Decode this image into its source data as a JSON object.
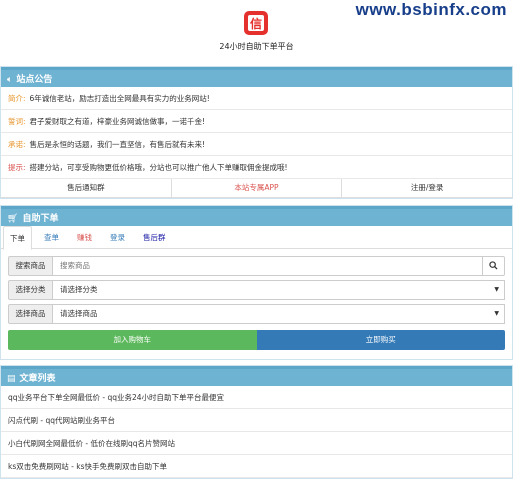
{
  "watermark": "www.bsbinfx.com",
  "site": {
    "logo_char": "信",
    "title": "24小时自助下单平台"
  },
  "notice": {
    "heading": "站点公告",
    "rows": [
      {
        "tag": "简介:",
        "text": "6年诚信老站，励志打造出全网最具有实力的业务网站!"
      },
      {
        "tag": "誓词:",
        "text": "君子爱财取之有道，梓豪业务网诚信做事，一诺千金!"
      },
      {
        "tag": "承诺:",
        "text": "售后是永恒的话题，我们一直坚信，有售后就有未来!"
      },
      {
        "tag": "提示:",
        "text": "搭建分站，可享受购物更低价格哦，分站也可以推广他人下单赚取佣金提成哦!"
      }
    ],
    "buttons": [
      "售后通知群",
      "本站专属APP",
      "注册/登录"
    ]
  },
  "order": {
    "heading": "自助下单",
    "tabs": [
      "下单",
      "查单",
      "赚钱",
      "登录",
      "售后群"
    ],
    "search_label": "搜索商品",
    "search_placeholder": "搜索商品",
    "category_label": "选择分类",
    "category_value": "请选择分类",
    "product_label": "选择商品",
    "product_value": "请选择商品",
    "cart_button": "加入购物车",
    "buy_button": "立即购买"
  },
  "articles": {
    "heading": "文章列表",
    "items": [
      "qq业务平台下单全网最低价 - qq业务24小时自助下单平台最便宜",
      "闪点代刷 - qq代网站刷业务平台",
      "小白代刷网全网最低价 - 低价在线刷qq名片赞网站",
      "ks双击免费刷网站 - ks快手免费刷双击自助下单"
    ]
  }
}
